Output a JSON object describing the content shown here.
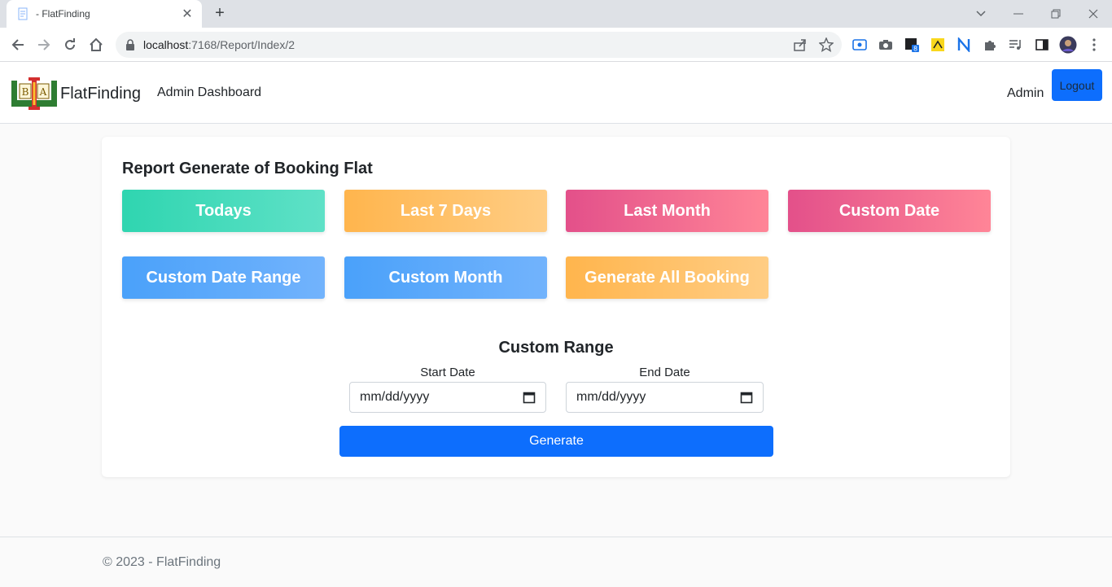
{
  "browser": {
    "tab_title": "- FlatFinding",
    "tab_close": "✕",
    "new_tab": "+",
    "url_host": "localhost",
    "url_rest": ":7168/Report/Index/2"
  },
  "navbar": {
    "brand_name": "FlatFinding",
    "nav_link": "Admin Dashboard",
    "user_label": "Admin",
    "logout_label": "Logout"
  },
  "report": {
    "heading": "Report Generate of Booking Flat",
    "buttons": [
      {
        "label": "Todays",
        "color": "#2fd5b0"
      },
      {
        "label": "Last 7 Days",
        "color": "#ffb54d"
      },
      {
        "label": "Last Month",
        "color": "#e3508a"
      },
      {
        "label": "Custom Date",
        "color": "#e3508a"
      },
      {
        "label": "Custom Date Range",
        "color": "#4aa1fa"
      },
      {
        "label": "Custom Month",
        "color": "#4aa1fa"
      },
      {
        "label": "Generate All Booking",
        "color": "#ffb54d"
      }
    ],
    "range_title": "Custom Range",
    "start_label": "Start Date",
    "end_label": "End Date",
    "start_value": "mm/dd/yyyy",
    "end_value": "mm/dd/yyyy",
    "generate_label": "Generate"
  },
  "footer": {
    "text": "© 2023 - FlatFinding"
  },
  "colors": {
    "primary": "#0d6efd",
    "background": "#fafafa"
  }
}
